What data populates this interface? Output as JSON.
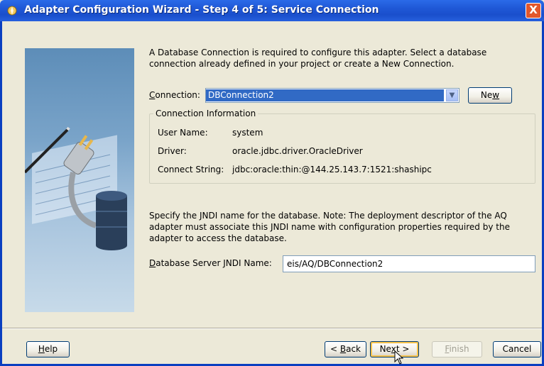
{
  "window": {
    "title": "Adapter Configuration Wizard - Step 4 of 5: Service Connection",
    "close_label": "X"
  },
  "intro": {
    "line1": "A Database Connection is required to configure this adapter. Select a database",
    "line2": "connection already defined in your project or create a New Connection."
  },
  "connection": {
    "label_pre": "C",
    "label_post": "onnection:",
    "value": "DBConnection2",
    "new_pre": "Ne",
    "new_key": "w",
    "new_post": ""
  },
  "connection_info": {
    "legend": "Connection Information",
    "rows": [
      {
        "label": "User Name:",
        "value": "system"
      },
      {
        "label": "Driver:",
        "value": "oracle.jdbc.driver.OracleDriver"
      },
      {
        "label": "Connect String:",
        "value": "jdbc:oracle:thin:@144.25.143.7:1521:shashipc"
      }
    ]
  },
  "jndi_note": {
    "line1": "Specify the JNDI name for the database.  Note: The deployment descriptor of the AQ",
    "line2": "adapter must associate this JNDI name with configuration properties required by the",
    "line3": "adapter to access the database."
  },
  "jndi": {
    "label_pre": "",
    "label_key": "D",
    "label_post": "atabase Server JNDI Name:",
    "value": "eis/AQ/DBConnection2"
  },
  "buttons": {
    "help_pre": "",
    "help_key": "H",
    "help_post": "elp",
    "back_pre": "< ",
    "back_key": "B",
    "back_post": "ack",
    "next_pre": "Ne",
    "next_key": "x",
    "next_post": "t >",
    "finish_pre": "",
    "finish_key": "F",
    "finish_post": "inish",
    "cancel": "Cancel"
  },
  "colors": {
    "title_bar": "#1f57d6",
    "selection": "#316ac5",
    "dialog_bg": "#ece9d8",
    "close_button": "#e2572c"
  }
}
